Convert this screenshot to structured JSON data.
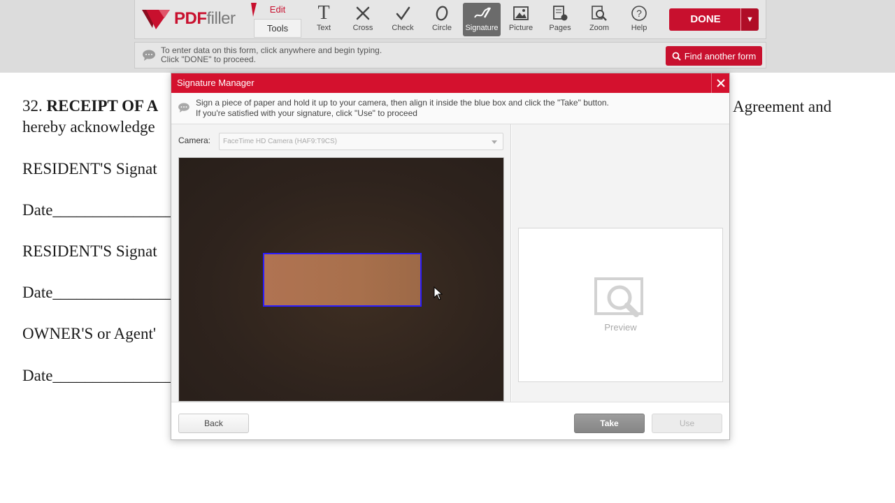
{
  "app": {
    "brand_primary": "PDF",
    "brand_secondary": "filler",
    "accent_color": "#c8102e"
  },
  "toolbar": {
    "edit_label": "Edit",
    "tools_label": "Tools",
    "tools": [
      {
        "icon": "text-icon",
        "label": "Text"
      },
      {
        "icon": "cross-icon",
        "label": "Cross"
      },
      {
        "icon": "check-icon",
        "label": "Check"
      },
      {
        "icon": "circle-icon",
        "label": "Circle"
      },
      {
        "icon": "signature-icon",
        "label": "Signature",
        "active": true
      },
      {
        "icon": "picture-icon",
        "label": "Picture"
      },
      {
        "icon": "pages-icon",
        "label": "Pages"
      },
      {
        "icon": "zoom-icon",
        "label": "Zoom"
      },
      {
        "icon": "help-icon",
        "label": "Help"
      }
    ],
    "done_label": "DONE"
  },
  "hint": {
    "line1": "To enter data on this form, click anywhere and begin typing.",
    "line2": "Click \"DONE\" to proceed.",
    "find_form_label": "Find another form"
  },
  "document": {
    "lines": [
      {
        "prefix": "32. ",
        "bold": "RECEIPT OF A",
        "rest": ""
      },
      {
        "prefix": "hereby acknowledge",
        "bold": "",
        "rest": ""
      },
      {
        "prefix": "RESIDENT'S Signat",
        "bold": "",
        "rest": ""
      },
      {
        "prefix": "Date_______________",
        "bold": "",
        "rest": ""
      },
      {
        "prefix": "RESIDENT'S Signat",
        "bold": "",
        "rest": ""
      },
      {
        "prefix": "Date_______________",
        "bold": "",
        "rest": ""
      },
      {
        "prefix": "OWNER'S or Agent'",
        "bold": "",
        "rest": ""
      },
      {
        "prefix": "Date_______________",
        "bold": "",
        "rest": ""
      }
    ],
    "right_fragment": "Agreement and"
  },
  "signature_manager": {
    "title": "Signature Manager",
    "instruction_line1": "Sign a piece of paper and hold it up to your camera, then align it inside the blue box and click the \"Take\" button.",
    "instruction_line2": "If you're satisfied with your signature, click \"Use\" to proceed",
    "camera_label": "Camera:",
    "camera_value": "FaceTime HD Camera (HAF9:T9CS)",
    "preview_label": "Preview",
    "back_label": "Back",
    "take_label": "Take",
    "use_label": "Use"
  }
}
